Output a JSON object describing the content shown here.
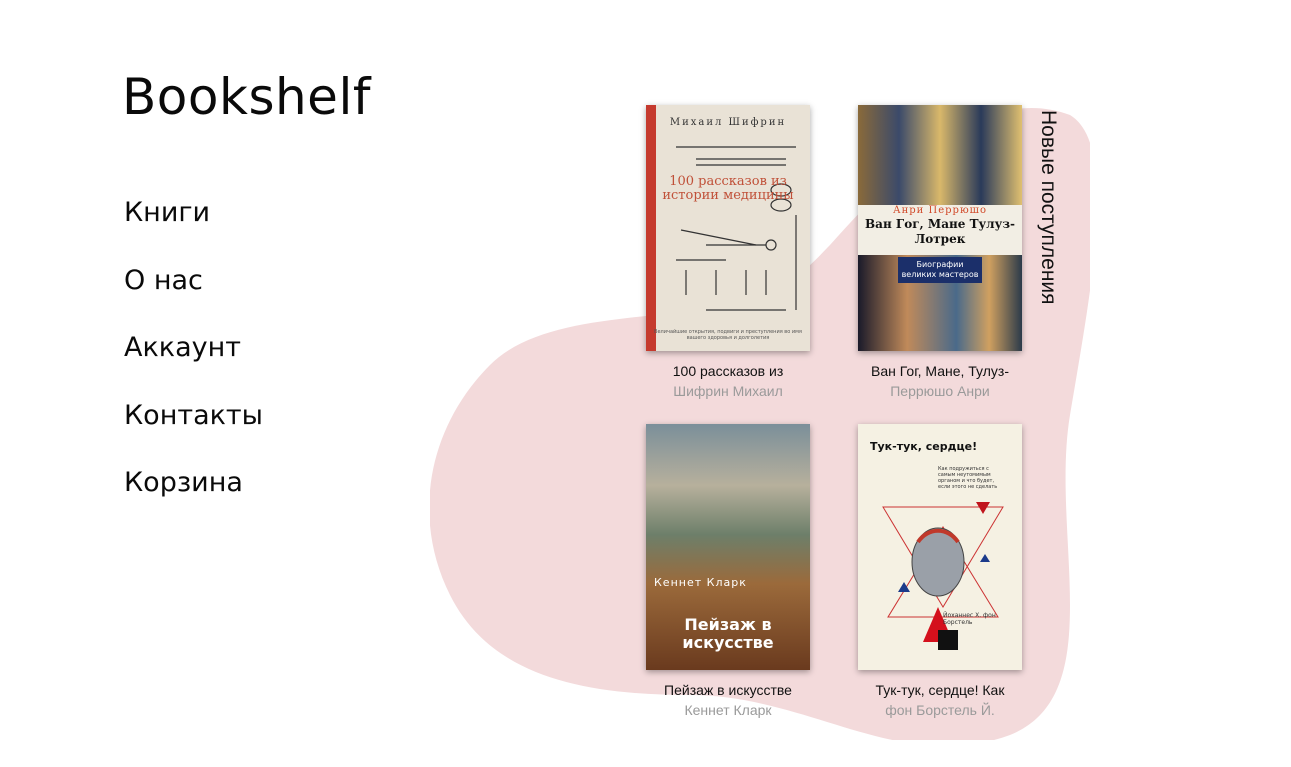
{
  "site": {
    "logo": "Bookshelf"
  },
  "nav": {
    "items": [
      "Книги",
      "О нас",
      "Аккаунт",
      "Контакты",
      "Корзина"
    ]
  },
  "section": {
    "title": "Новые поступления"
  },
  "books": [
    {
      "title": "100 рассказов из",
      "author": "Шифрин Михаил",
      "cover": {
        "author": "Михаил Шифрин",
        "title": "100 рассказов из истории медицины",
        "tagline": "Величайшие открытия, подвиги и преступления во имя вашего здоровья и долголетия"
      }
    },
    {
      "title": "Ван Гог, Мане, Тулуз-",
      "author": "Перрюшо Анри",
      "cover": {
        "author": "Анри Перрюшо",
        "title": "Ван Гог, Мане Тулуз-Лотрек",
        "series": "Биографии великих мастеров"
      }
    },
    {
      "title": "Пейзаж в искусстве",
      "author": "Кеннет Кларк",
      "cover": {
        "author": "Кеннет Кларк",
        "title": "Пейзаж в искусстве"
      }
    },
    {
      "title": "Тук-тук, сердце! Как",
      "author": "фон Борстель Й.",
      "cover": {
        "title": "Тук-тук, сердце!",
        "tagline": "Как подружиться с самым неутомимым органом и что будет, если этого не сделать",
        "author": "Йоханнес Х. фон Борстель"
      }
    }
  ],
  "colors": {
    "blob": "#f3dadb",
    "author_gray": "#9a9a9a",
    "text": "#111111"
  }
}
